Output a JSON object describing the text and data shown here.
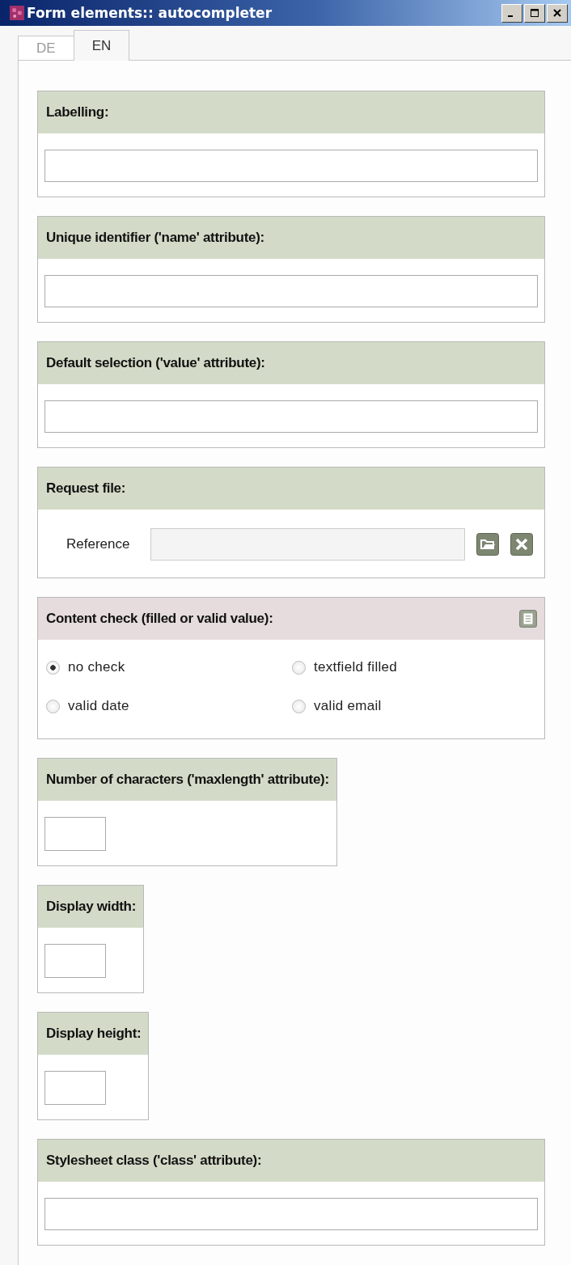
{
  "window": {
    "title": "Form elements:: autocompleter"
  },
  "tabs": [
    {
      "label": "DE",
      "selected": false
    },
    {
      "label": "EN",
      "selected": true
    }
  ],
  "sections": [
    {
      "kind": "text",
      "heading": "Labelling:"
    },
    {
      "kind": "text",
      "heading": "Unique identifier ('name' attribute):"
    },
    {
      "kind": "text",
      "heading": "Default selection ('value' attribute):"
    },
    {
      "kind": "file",
      "heading": "Request file:",
      "label": "Reference"
    },
    {
      "kind": "radio",
      "heading": "Content check (filled or valid value):",
      "options": [
        {
          "label": "no check",
          "selected": true
        },
        {
          "label": "textfield filled",
          "selected": false
        },
        {
          "label": "valid date",
          "selected": false
        },
        {
          "label": "valid email",
          "selected": false
        }
      ]
    },
    {
      "kind": "short",
      "heading": "Number of characters ('maxlength' attribute):"
    },
    {
      "kind": "short",
      "heading": "Display width:"
    },
    {
      "kind": "short",
      "heading": "Display height:"
    },
    {
      "kind": "text",
      "heading": "Stylesheet class ('class' attribute):"
    }
  ]
}
